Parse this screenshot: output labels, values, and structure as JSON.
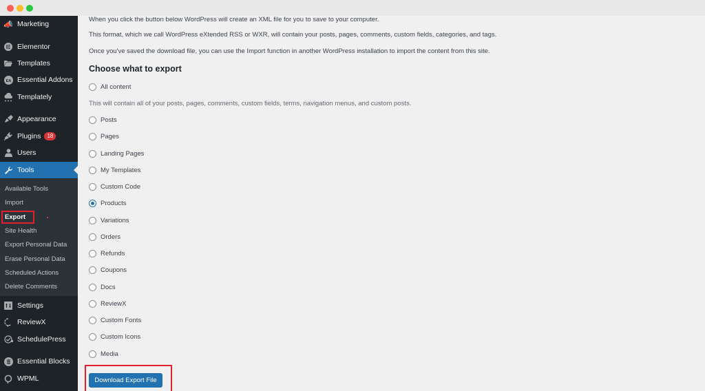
{
  "window": {
    "controls": [
      "close",
      "minimize",
      "maximize"
    ]
  },
  "sidebar": {
    "items": [
      {
        "label": "Marketing",
        "icon": "megaphone-icon"
      },
      {
        "label": "Elementor",
        "icon": "elementor-icon"
      },
      {
        "label": "Templates",
        "icon": "folder-icon"
      },
      {
        "label": "Essential Addons",
        "icon": "ea-icon"
      },
      {
        "label": "Templately",
        "icon": "cloud-icon"
      },
      {
        "label": "Appearance",
        "icon": "paintbrush-icon"
      },
      {
        "label": "Plugins",
        "icon": "plug-icon",
        "badge": "18"
      },
      {
        "label": "Users",
        "icon": "user-icon"
      },
      {
        "label": "Tools",
        "icon": "wrench-icon",
        "active": true
      },
      {
        "label": "Settings",
        "icon": "settings-icon"
      },
      {
        "label": "ReviewX",
        "icon": "reviewx-icon"
      },
      {
        "label": "SchedulePress",
        "icon": "schedule-icon"
      },
      {
        "label": "Essential Blocks",
        "icon": "blocks-icon"
      },
      {
        "label": "WPML",
        "icon": "wpml-icon"
      }
    ],
    "submenu": [
      {
        "label": "Available Tools"
      },
      {
        "label": "Import"
      },
      {
        "label": "Export",
        "current": true
      },
      {
        "label": "Site Health"
      },
      {
        "label": "Export Personal Data"
      },
      {
        "label": "Erase Personal Data"
      },
      {
        "label": "Scheduled Actions"
      },
      {
        "label": "Delete Comments"
      }
    ]
  },
  "main": {
    "paragraphs": [
      "When you click the button below WordPress will create an XML file for you to save to your computer.",
      "This format, which we call WordPress eXtended RSS or WXR, will contain your posts, pages, comments, custom fields, categories, and tags.",
      "Once you've saved the download file, you can use the Import function in another WordPress installation to import the content from this site."
    ],
    "heading": "Choose what to export",
    "all_content_label": "All content",
    "all_content_desc": "This will contain all of your posts, pages, comments, custom fields, terms, navigation menus, and custom posts.",
    "options": [
      {
        "label": "Posts",
        "checked": false
      },
      {
        "label": "Pages",
        "checked": false
      },
      {
        "label": "Landing Pages",
        "checked": false
      },
      {
        "label": "My Templates",
        "checked": false
      },
      {
        "label": "Custom Code",
        "checked": false
      },
      {
        "label": "Products",
        "checked": true
      },
      {
        "label": "Variations",
        "checked": false
      },
      {
        "label": "Orders",
        "checked": false
      },
      {
        "label": "Refunds",
        "checked": false
      },
      {
        "label": "Coupons",
        "checked": false
      },
      {
        "label": "Docs",
        "checked": false
      },
      {
        "label": "ReviewX",
        "checked": false
      },
      {
        "label": "Custom Fonts",
        "checked": false
      },
      {
        "label": "Custom Icons",
        "checked": false
      },
      {
        "label": "Media",
        "checked": false
      }
    ],
    "download_button": "Download Export File"
  },
  "colors": {
    "accent": "#2271b1",
    "sidebar_bg": "#1d2327",
    "submenu_bg": "#2c3338",
    "badge": "#d63638",
    "highlight_box": "#e0202a"
  }
}
